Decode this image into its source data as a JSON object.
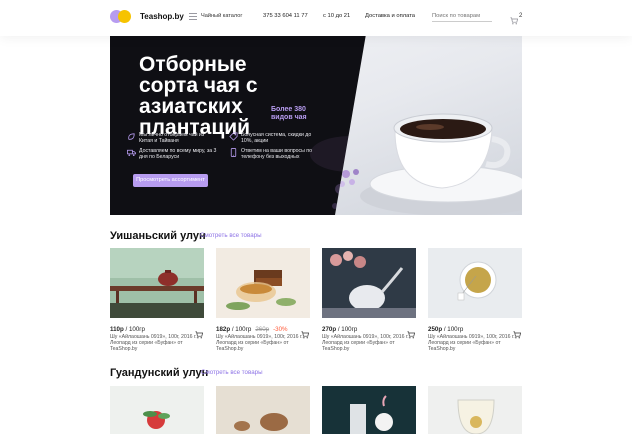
{
  "header": {
    "brand": "Teashop.by",
    "catalog": "Чайный каталог",
    "phone": "375 33 604 11 77",
    "hours": "с 10 до 21",
    "delivery": "Доставка и оплата",
    "search_placeholder": "Поиск по товарам",
    "cart_count": "2"
  },
  "hero": {
    "title": "Отборные сорта чая с азиатских плантаций",
    "subtitle": "Более 380 видов чая",
    "features": [
      "Мы лично отбираем чай из Китая и Тайваня",
      "Бонусная система, скидки до 10%, акции",
      "Доставляем по всему миру, за 3 дня по Беларуси",
      "Ответим на ваши вопросы по телефону без выходных"
    ],
    "button": "Просмотреть ассортимент"
  },
  "sections": [
    {
      "title": "Уишаньский улун",
      "link": "Смотреть все товары",
      "products": [
        {
          "price": "110р",
          "unit": "/ 100гр",
          "old": "",
          "discount": "",
          "description": "Шу «Айлаошань 0919», 100г, 2016 г. Леопард из серии «Буфан» от TeaShop.by"
        },
        {
          "price": "182р",
          "unit": "/ 100гр",
          "old": "260р",
          "discount": "-30%",
          "description": "Шу «Айлаошань 0919», 100г, 2016 г. Леопард из серии «Буфан» от TeaShop.by"
        },
        {
          "price": "270р",
          "unit": "/ 100гр",
          "old": "",
          "discount": "",
          "description": "Шу «Айлаошань 0919», 100г, 2016 г. Леопард из серии «Буфан» от TeaShop.by"
        },
        {
          "price": "250р",
          "unit": "/ 100гр",
          "old": "",
          "discount": "",
          "description": "Шу «Айлаошань 0919», 100г, 2016 г. Леопард из серии «Буфан» от TeaShop.by"
        }
      ]
    },
    {
      "title": "Гуандунский улун",
      "link": "Смотреть все товары"
    }
  ]
}
